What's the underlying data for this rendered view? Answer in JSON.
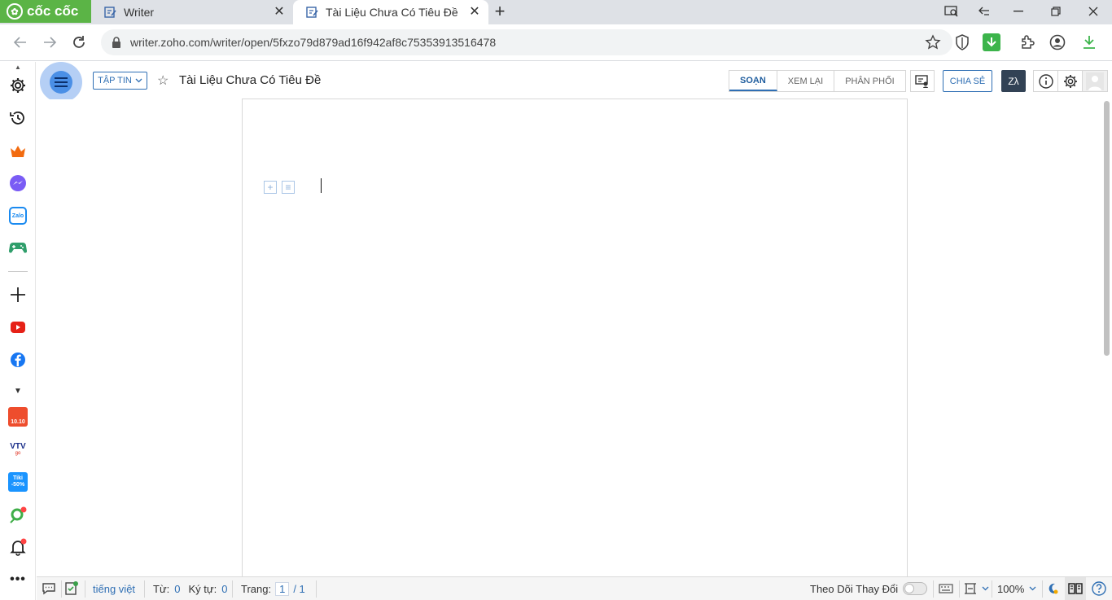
{
  "browser": {
    "brand": "cốc cốc",
    "tabs": [
      {
        "title": "Writer"
      },
      {
        "title": "Tài Liệu Chưa Có Tiêu Đề"
      }
    ],
    "url": "writer.zoho.com/writer/open/5fxzo79d879ad16f942af8c75353913516478"
  },
  "sidebar_icons": [
    "settings-icon",
    "history-icon",
    "crown-icon",
    "messenger-icon",
    "zalo-icon",
    "game-icon",
    "add-icon",
    "youtube-icon",
    "facebook-icon",
    "more-down-icon",
    "shopee-icon",
    "vtv-go-icon",
    "tiki-icon",
    "lollipop-icon",
    "notification-icon",
    "more-icon"
  ],
  "sidebar_text": {
    "shopee": "10.10",
    "vtv": "VTV",
    "vtv_sub": "go",
    "tiki": "Tiki",
    "tiki_sub": "-50%",
    "zalo": "Zalo"
  },
  "header": {
    "file_label": "TẬP TIN",
    "doc_title": "Tài Liệu Chưa Có Tiêu Đề",
    "modes": [
      "SOẠN",
      "XEM LẠI",
      "PHÂN PHỐI"
    ],
    "active_mode": "SOẠN",
    "share_label": "CHIA SẺ",
    "z_label": "Zλ"
  },
  "statusbar": {
    "language": "tiếng việt",
    "words_label": "Từ:",
    "words": "0",
    "chars_label": "Ký tự:",
    "chars": "0",
    "page_label": "Trang:",
    "page_current": "1",
    "page_total": "/ 1",
    "track_changes": "Theo Dõi Thay Đổi",
    "zoom": "100%"
  },
  "colors": {
    "accent": "#2f6fb4",
    "brand_green": "#5bb446",
    "dark_button": "#324255"
  }
}
